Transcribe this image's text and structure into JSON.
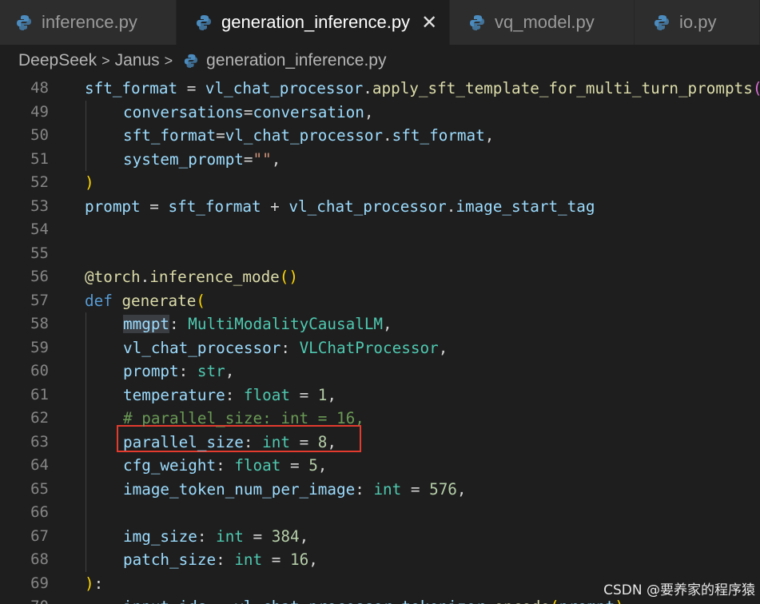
{
  "tabs": [
    {
      "label": "inference.py",
      "active": false
    },
    {
      "label": "generation_inference.py",
      "active": true
    },
    {
      "label": "vq_model.py",
      "active": false
    },
    {
      "label": "io.py",
      "active": false
    }
  ],
  "breadcrumb": {
    "items": [
      "DeepSeek",
      "Janus",
      "generation_inference.py"
    ]
  },
  "editor": {
    "lines": [
      {
        "n": "48",
        "indent": 0,
        "tokens": [
          [
            "var",
            "sft_format"
          ],
          [
            "plain",
            " = "
          ],
          [
            "var",
            "vl_chat_processor"
          ],
          [
            "plain",
            "."
          ],
          [
            "fn",
            "apply_sft_template_for_multi_turn_prompts"
          ],
          [
            "br2",
            "("
          ]
        ]
      },
      {
        "n": "49",
        "indent": 1,
        "tokens": [
          [
            "var",
            "conversations"
          ],
          [
            "plain",
            "="
          ],
          [
            "var",
            "conversation"
          ],
          [
            "plain",
            ","
          ]
        ]
      },
      {
        "n": "50",
        "indent": 1,
        "tokens": [
          [
            "var",
            "sft_format"
          ],
          [
            "plain",
            "="
          ],
          [
            "var",
            "vl_chat_processor"
          ],
          [
            "plain",
            "."
          ],
          [
            "var",
            "sft_format"
          ],
          [
            "plain",
            ","
          ]
        ]
      },
      {
        "n": "51",
        "indent": 1,
        "tokens": [
          [
            "var",
            "system_prompt"
          ],
          [
            "plain",
            "="
          ],
          [
            "str",
            "\"\""
          ],
          [
            "plain",
            ","
          ]
        ]
      },
      {
        "n": "52",
        "indent": 0,
        "tokens": [
          [
            "br1",
            ")"
          ]
        ]
      },
      {
        "n": "53",
        "indent": 0,
        "tokens": [
          [
            "var",
            "prompt"
          ],
          [
            "plain",
            " = "
          ],
          [
            "var",
            "sft_format"
          ],
          [
            "plain",
            " + "
          ],
          [
            "var",
            "vl_chat_processor"
          ],
          [
            "plain",
            "."
          ],
          [
            "var",
            "image_start_tag"
          ]
        ]
      },
      {
        "n": "54",
        "indent": 0,
        "tokens": []
      },
      {
        "n": "55",
        "indent": 0,
        "tokens": []
      },
      {
        "n": "56",
        "indent": 0,
        "tokens": [
          [
            "fn",
            "@torch"
          ],
          [
            "plain",
            "."
          ],
          [
            "fn",
            "inference_mode"
          ],
          [
            "br1",
            "()"
          ]
        ]
      },
      {
        "n": "57",
        "indent": 0,
        "tokens": [
          [
            "kw",
            "def"
          ],
          [
            "plain",
            " "
          ],
          [
            "fn",
            "generate"
          ],
          [
            "br1",
            "("
          ]
        ]
      },
      {
        "n": "58",
        "indent": 1,
        "tokens": [
          [
            "var",
            "mmgpt"
          ],
          [
            "plain",
            ": "
          ],
          [
            "typ",
            "MultiModalityCausalLM"
          ],
          [
            "plain",
            ","
          ]
        ]
      },
      {
        "n": "59",
        "indent": 1,
        "tokens": [
          [
            "var",
            "vl_chat_processor"
          ],
          [
            "plain",
            ": "
          ],
          [
            "typ",
            "VLChatProcessor"
          ],
          [
            "plain",
            ","
          ]
        ]
      },
      {
        "n": "60",
        "indent": 1,
        "tokens": [
          [
            "var",
            "prompt"
          ],
          [
            "plain",
            ": "
          ],
          [
            "typ",
            "str"
          ],
          [
            "plain",
            ","
          ]
        ]
      },
      {
        "n": "61",
        "indent": 1,
        "tokens": [
          [
            "var",
            "temperature"
          ],
          [
            "plain",
            ": "
          ],
          [
            "typ",
            "float"
          ],
          [
            "plain",
            " = "
          ],
          [
            "num",
            "1"
          ],
          [
            "plain",
            ","
          ]
        ]
      },
      {
        "n": "62",
        "indent": 1,
        "tokens": [
          [
            "cmt",
            "# parallel_size: int = 16,"
          ]
        ]
      },
      {
        "n": "63",
        "indent": 1,
        "tokens": [
          [
            "var",
            "parallel_size"
          ],
          [
            "plain",
            ": "
          ],
          [
            "typ",
            "int"
          ],
          [
            "plain",
            " = "
          ],
          [
            "num",
            "8"
          ],
          [
            "plain",
            ","
          ]
        ]
      },
      {
        "n": "64",
        "indent": 1,
        "tokens": [
          [
            "var",
            "cfg_weight"
          ],
          [
            "plain",
            ": "
          ],
          [
            "typ",
            "float"
          ],
          [
            "plain",
            " = "
          ],
          [
            "num",
            "5"
          ],
          [
            "plain",
            ","
          ]
        ]
      },
      {
        "n": "65",
        "indent": 1,
        "tokens": [
          [
            "var",
            "image_token_num_per_image"
          ],
          [
            "plain",
            ": "
          ],
          [
            "typ",
            "int"
          ],
          [
            "plain",
            " = "
          ],
          [
            "num",
            "576"
          ],
          [
            "plain",
            ","
          ]
        ]
      },
      {
        "n": "66",
        "indent": 0,
        "tokens": []
      },
      {
        "n": "67",
        "indent": 1,
        "tokens": [
          [
            "var",
            "img_size"
          ],
          [
            "plain",
            ": "
          ],
          [
            "typ",
            "int"
          ],
          [
            "plain",
            " = "
          ],
          [
            "num",
            "384"
          ],
          [
            "plain",
            ","
          ]
        ]
      },
      {
        "n": "68",
        "indent": 1,
        "tokens": [
          [
            "var",
            "patch_size"
          ],
          [
            "plain",
            ": "
          ],
          [
            "typ",
            "int"
          ],
          [
            "plain",
            " = "
          ],
          [
            "num",
            "16"
          ],
          [
            "plain",
            ","
          ]
        ]
      },
      {
        "n": "69",
        "indent": 0,
        "tokens": [
          [
            "br1",
            ")"
          ],
          [
            "plain",
            ":"
          ]
        ]
      },
      {
        "n": "70",
        "indent": 1,
        "tokens": [
          [
            "var",
            "input_ids"
          ],
          [
            "plain",
            " = "
          ],
          [
            "var",
            "vl_chat_processor"
          ],
          [
            "plain",
            "."
          ],
          [
            "var",
            "tokenizer"
          ],
          [
            "plain",
            "."
          ],
          [
            "fn",
            "encode"
          ],
          [
            "br1",
            "("
          ],
          [
            "var",
            "prompt"
          ],
          [
            "br1",
            ")"
          ]
        ]
      }
    ]
  },
  "watermark": "CSDN @要养家的程序猿",
  "colors": {
    "accent_box": "#e33b2e",
    "python_icon": "#4b8bbe"
  },
  "icons": {
    "file": "python-icon",
    "tab_close": "close-icon",
    "breadcrumb_sep": "chevron-right-icon"
  }
}
